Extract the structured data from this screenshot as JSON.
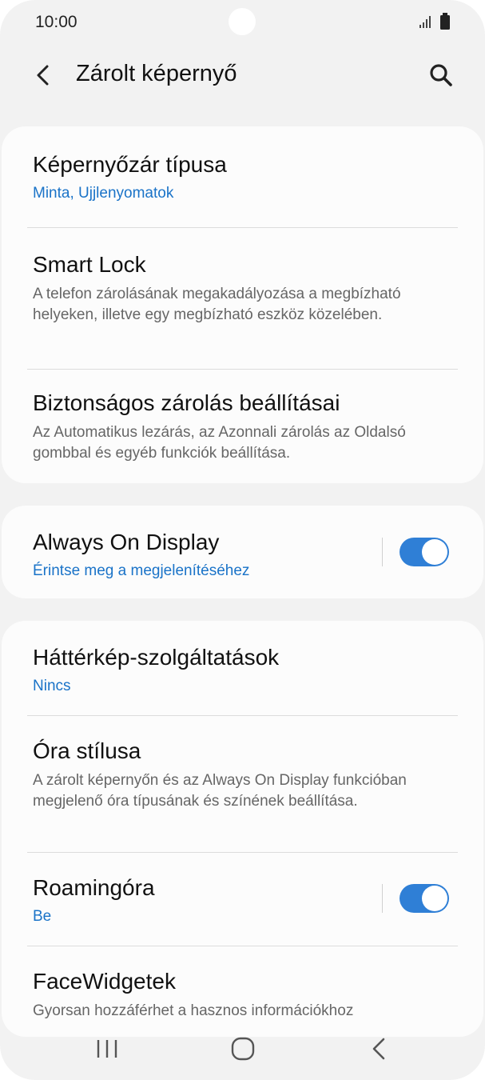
{
  "status_bar": {
    "time": "10:00"
  },
  "header": {
    "title": "Zárolt képernyő"
  },
  "section1": {
    "lock_type": {
      "title": "Képernyőzár típusa",
      "value": "Minta, Ujjlenyomatok"
    },
    "smart_lock": {
      "title": "Smart Lock",
      "description": "A telefon zárolásának megakadályozása a megbízható helyeken, illetve egy megbízható eszköz közelében."
    },
    "secure_lock": {
      "title": "Biztonságos zárolás beállításai",
      "description": "Az Automatikus lezárás, az Azonnali zárolás az Oldalsó gombbal és egyéb funkciók beállítása."
    }
  },
  "section2": {
    "always_on_display": {
      "title": "Always On Display",
      "subtitle": "Érintse meg a megjelenítéséhez",
      "enabled": true
    }
  },
  "section3": {
    "wallpaper_services": {
      "title": "Háttérkép-szolgáltatások",
      "value": "Nincs"
    },
    "clock_style": {
      "title": "Óra stílusa",
      "description": "A zárolt képernyőn és az Always On Display funkcióban megjelenő óra típusának és színének beállítása."
    },
    "roaming_clock": {
      "title": "Roamingóra",
      "value": "Be",
      "enabled": true
    },
    "face_widgets": {
      "title": "FaceWidgetek",
      "description": "Gyorsan hozzáférhet a hasznos információkhoz"
    }
  },
  "colors": {
    "accent": "#1a73c8",
    "toggle_on": "#2f7fd6",
    "background": "#f2f2f2",
    "card": "#fcfcfc"
  },
  "icons": {
    "back": "back-arrow-icon",
    "search": "search-icon",
    "recents": "recents-icon",
    "home": "home-icon",
    "nav_back": "nav-back-icon"
  }
}
